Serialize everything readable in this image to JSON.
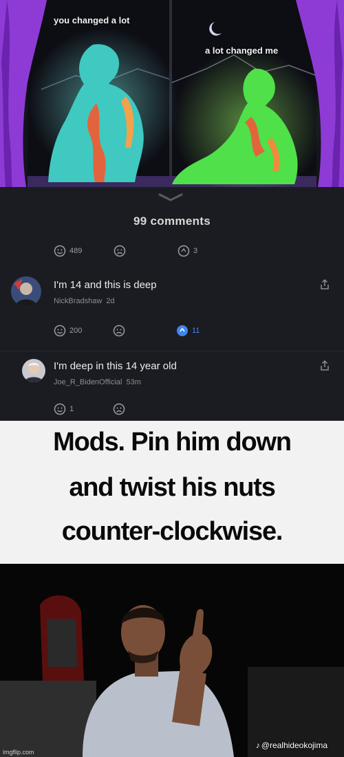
{
  "art": {
    "caption_left": "you changed a lot",
    "caption_right": "a lot changed me"
  },
  "comments_panel": {
    "title": "99 comments",
    "post_reactions": {
      "likes": "489",
      "replies": "3"
    },
    "comments": [
      {
        "text": "I'm 14 and this is deep",
        "author": "NickBradshaw",
        "time": "2d",
        "likes": "200",
        "replies": "11"
      },
      {
        "text": "I'm deep in this 14 year old",
        "author": "Joe_R_BidenOfficial",
        "time": "53m",
        "likes": "1"
      }
    ]
  },
  "caption": {
    "line1": "Mods. Pin him down",
    "line2": "and twist his nuts",
    "line3": "counter-clockwise."
  },
  "video": {
    "tiktok_glyph": "♪",
    "handle": "@realhideokojima",
    "watermark": "imgflip.com"
  },
  "icons": [
    "smiley-icon",
    "frown-icon",
    "reply-icon",
    "share-icon",
    "chevron-down-icon"
  ],
  "colors": {
    "panel_bg": "#1b1c21",
    "curtain": "#8e3bd6",
    "figure_left": "#3fc9c0",
    "figure_right": "#4fe04a",
    "reply_active": "#3d86f0"
  }
}
